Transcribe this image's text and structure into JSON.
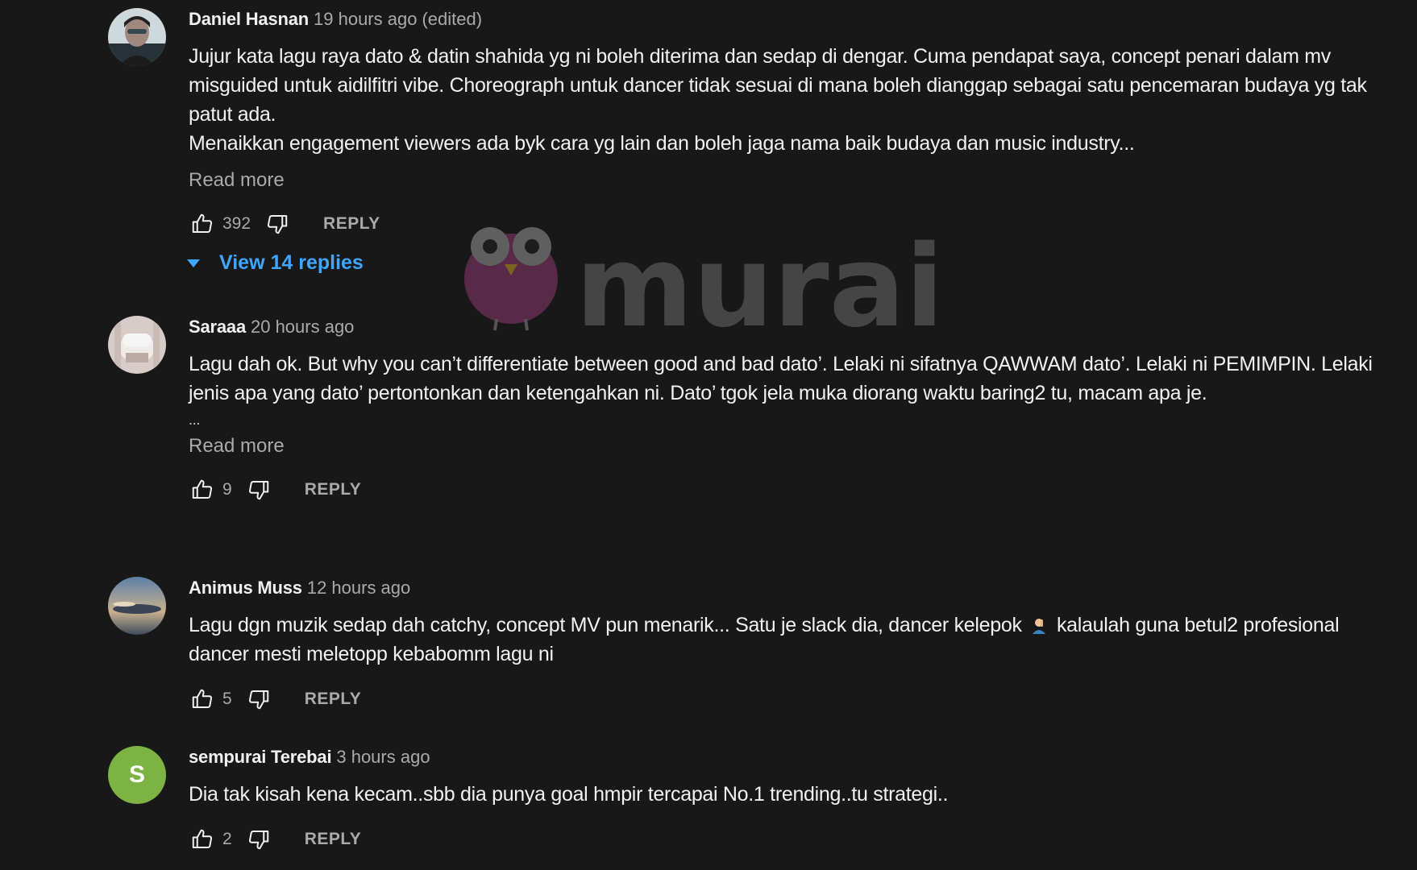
{
  "comments": [
    {
      "author": "Daniel Hasnan",
      "time": "19 hours ago",
      "edited": "(edited)",
      "paragraphs": [
        "Jujur kata lagu raya dato & datin shahida yg ni boleh diterima dan sedap di dengar. Cuma pendapat saya, concept penari dalam mv misguided untuk aidilfitri vibe. Choreograph untuk dancer tidak sesuai di mana boleh dianggap sebagai satu pencemaran budaya yg tak patut ada.",
        "Menaikkan engagement viewers ada byk cara yg lain dan boleh jaga nama baik budaya dan music industry..."
      ],
      "read_more": "Read more",
      "likes": "392",
      "reply_label": "REPLY",
      "view_replies": "View 14 replies"
    },
    {
      "author": "Saraaa",
      "time": "20 hours ago",
      "paragraphs": [
        "Lagu dah ok. But why you can’t differentiate between good and bad dato’. Lelaki ni sifatnya QAWWAM dato’. Lelaki ni PEMIMPIN. Lelaki jenis apa yang dato’ pertontonkan dan ketengahkan ni. Dato’ tgok jela muka diorang waktu baring2 tu, macam apa je."
      ],
      "ellipsis": "...",
      "read_more": "Read more",
      "likes": "9",
      "reply_label": "REPLY"
    },
    {
      "author": "Animus Muss",
      "time": "12 hours ago",
      "text_before_emoji": "Lagu dgn muzik sedap dah catchy, concept MV pun menarik... Satu je slack dia, dancer kelepok",
      "emoji": "facepalm-emoji",
      "text_after_emoji": "kalaulah guna betul2 profesional dancer mesti meletopp kebabomm lagu ni",
      "likes": "5",
      "reply_label": "REPLY"
    },
    {
      "author": "sempurai Terebai",
      "time": "3 hours ago",
      "avatar_letter": "S",
      "paragraphs": [
        "Dia tak kisah kena kecam..sbb dia punya goal hmpir tercapai No.1 trending..tu strategi.."
      ],
      "likes": "2",
      "reply_label": "REPLY"
    }
  ],
  "watermark": {
    "text": "murai"
  },
  "colors": {
    "background": "#181818",
    "link_blue": "#3ea6ff",
    "secondary_text": "#aaaaaa",
    "avatar_green": "#7cb342"
  }
}
